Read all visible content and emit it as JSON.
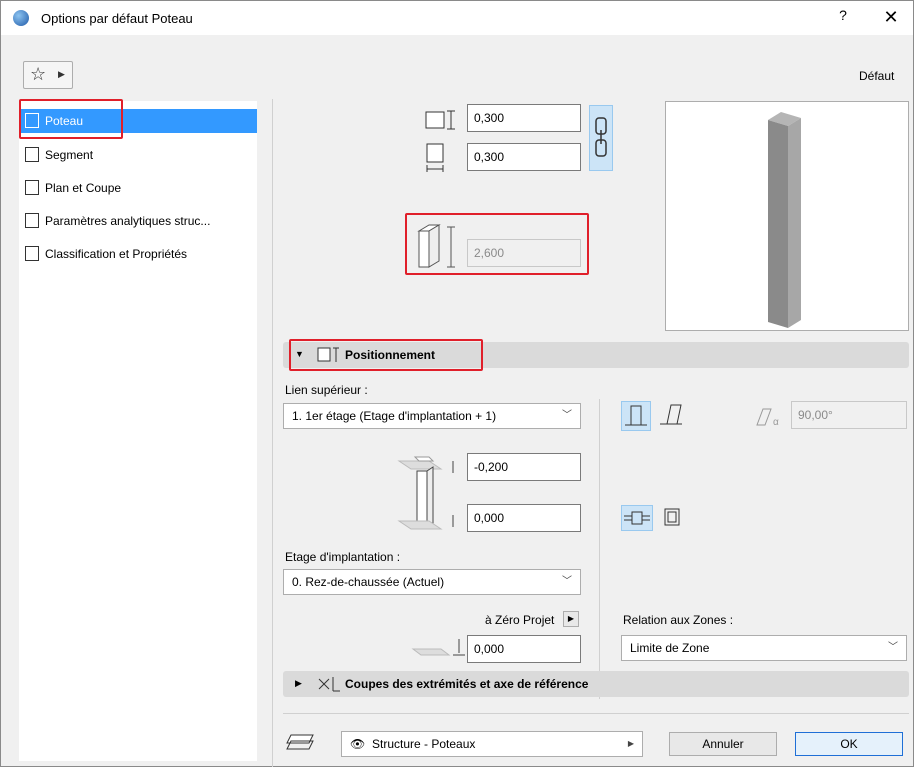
{
  "window": {
    "title": "Options par défaut Poteau",
    "help": "?",
    "close": "✕"
  },
  "toolbar": {
    "default_label": "Défaut"
  },
  "sidebar": {
    "items": [
      {
        "label": "Poteau",
        "icon": "column-icon",
        "selected": true
      },
      {
        "label": "Segment",
        "icon": "segment-icon"
      },
      {
        "label": "Plan et Coupe",
        "icon": "plan-section-icon"
      },
      {
        "label": "Paramètres analytiques struc...",
        "icon": "structural-analytic-icon"
      },
      {
        "label": "Classification et Propriétés",
        "icon": "classification-icon"
      }
    ]
  },
  "dimensions": {
    "width": "0,300",
    "depth": "0,300",
    "height": "2,600"
  },
  "positioning": {
    "section_title": "Positionnement",
    "top_link_label": "Lien supérieur :",
    "top_link_value": "1. 1er étage (Etage d'implantation + 1)",
    "top_offset": "-0,200",
    "bottom_offset": "0,000",
    "angle": "90,00°",
    "home_story_label": "Etage d'implantation :",
    "home_story_value": "0. Rez-de-chaussée (Actuel)",
    "to_project_zero_label": "à Zéro Projet",
    "project_zero_value": "0,000",
    "zone_relation_label": "Relation aux Zones :",
    "zone_relation_value": "Limite de Zone"
  },
  "cut_section": {
    "title": "Coupes des extrémités et axe de référence"
  },
  "footer": {
    "layer_value": "Structure - Poteaux",
    "cancel_label": "Annuler",
    "ok_label": "OK"
  },
  "colors": {
    "accent": "#3399ff",
    "highlight": "#e01f2a"
  }
}
